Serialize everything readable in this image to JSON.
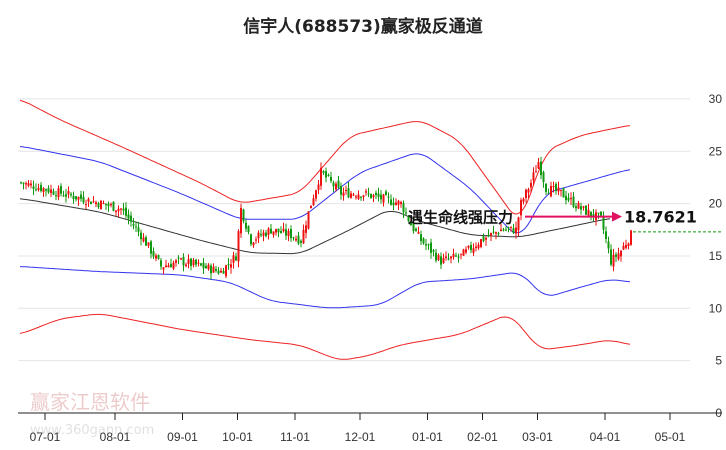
{
  "chart_data": {
    "type": "candlestick",
    "title": "信宇人(688573)赢家极反通道",
    "yticks": [
      0,
      5,
      10,
      15,
      20,
      25,
      30
    ],
    "ylim": [
      0,
      30
    ],
    "xticks": [
      "07-01",
      "08-01",
      "09-01",
      "10-01",
      "11-01",
      "12-01",
      "01-01",
      "02-01",
      "03-01",
      "04-01",
      "05-01"
    ],
    "xtick_days": [
      10,
      38,
      65,
      87,
      110,
      136,
      163,
      185,
      207,
      234,
      260
    ],
    "total_days": 270,
    "close_path": [
      [
        0,
        22
      ],
      [
        8,
        21.5
      ],
      [
        16,
        21
      ],
      [
        24,
        20.5
      ],
      [
        32,
        20
      ],
      [
        40,
        19.5
      ],
      [
        48,
        17
      ],
      [
        56,
        14
      ],
      [
        64,
        14.5
      ],
      [
        72,
        14
      ],
      [
        80,
        13.5
      ],
      [
        86,
        15
      ],
      [
        88,
        19.5
      ],
      [
        92,
        16.5
      ],
      [
        100,
        17.5
      ],
      [
        108,
        17
      ],
      [
        112,
        16.5
      ],
      [
        116,
        20
      ],
      [
        120,
        23
      ],
      [
        124,
        22
      ],
      [
        128,
        21
      ],
      [
        136,
        21
      ],
      [
        144,
        20.5
      ],
      [
        152,
        20
      ],
      [
        156,
        18
      ],
      [
        160,
        16.5
      ],
      [
        168,
        14.5
      ],
      [
        176,
        15
      ],
      [
        184,
        16.5
      ],
      [
        192,
        17.5
      ],
      [
        198,
        17.5
      ],
      [
        200,
        20
      ],
      [
        204,
        22
      ],
      [
        207,
        24
      ],
      [
        210,
        21.5
      ],
      [
        216,
        21
      ],
      [
        224,
        19.5
      ],
      [
        232,
        18.5
      ],
      [
        236,
        14.5
      ],
      [
        240,
        15.5
      ],
      [
        244,
        17
      ]
    ],
    "lines": {
      "middle": [
        [
          0,
          20.5
        ],
        [
          32,
          19.2
        ],
        [
          72,
          16.5
        ],
        [
          92,
          15.3
        ],
        [
          112,
          15.2
        ],
        [
          132,
          17.5
        ],
        [
          148,
          19.5
        ],
        [
          160,
          18.3
        ],
        [
          180,
          17
        ],
        [
          200,
          16.8
        ],
        [
          220,
          17.8
        ],
        [
          236,
          18.6
        ]
      ],
      "upper_blue": [
        [
          0,
          25.5
        ],
        [
          32,
          24
        ],
        [
          64,
          21
        ],
        [
          88,
          18.5
        ],
        [
          112,
          18.5
        ],
        [
          136,
          23
        ],
        [
          160,
          25
        ],
        [
          180,
          21.5
        ],
        [
          200,
          16.5
        ],
        [
          210,
          21
        ],
        [
          244,
          23.3
        ]
      ],
      "lower_blue": [
        [
          0,
          14
        ],
        [
          32,
          13.5
        ],
        [
          64,
          13.2
        ],
        [
          84,
          12.5
        ],
        [
          100,
          10.7
        ],
        [
          124,
          10
        ],
        [
          144,
          10.3
        ],
        [
          160,
          12.5
        ],
        [
          180,
          12.8
        ],
        [
          200,
          13.5
        ],
        [
          210,
          11
        ],
        [
          224,
          12
        ],
        [
          236,
          12.8
        ],
        [
          244,
          12.5
        ]
      ],
      "upper_red": [
        [
          0,
          30
        ],
        [
          16,
          28
        ],
        [
          40,
          25.5
        ],
        [
          72,
          22
        ],
        [
          88,
          20
        ],
        [
          112,
          21
        ],
        [
          132,
          26.5
        ],
        [
          160,
          28
        ],
        [
          176,
          26
        ],
        [
          200,
          18
        ],
        [
          210,
          25
        ],
        [
          224,
          26.5
        ],
        [
          244,
          27.5
        ]
      ],
      "lower_red": [
        [
          0,
          7.5
        ],
        [
          16,
          9
        ],
        [
          32,
          9.5
        ],
        [
          64,
          8
        ],
        [
          92,
          7
        ],
        [
          112,
          6.5
        ],
        [
          128,
          5
        ],
        [
          140,
          5.5
        ],
        [
          152,
          6.5
        ],
        [
          176,
          7.5
        ],
        [
          196,
          9.5
        ],
        [
          208,
          6
        ],
        [
          224,
          6.5
        ],
        [
          236,
          7
        ],
        [
          244,
          6.5
        ]
      ]
    },
    "annotation": {
      "text": "遇生命线强压力",
      "value": "18.7621",
      "price": 18.76
    },
    "last_price": 17.3
  },
  "watermark": {
    "name": "赢家江恩软件",
    "url": "www.360gann.com"
  }
}
